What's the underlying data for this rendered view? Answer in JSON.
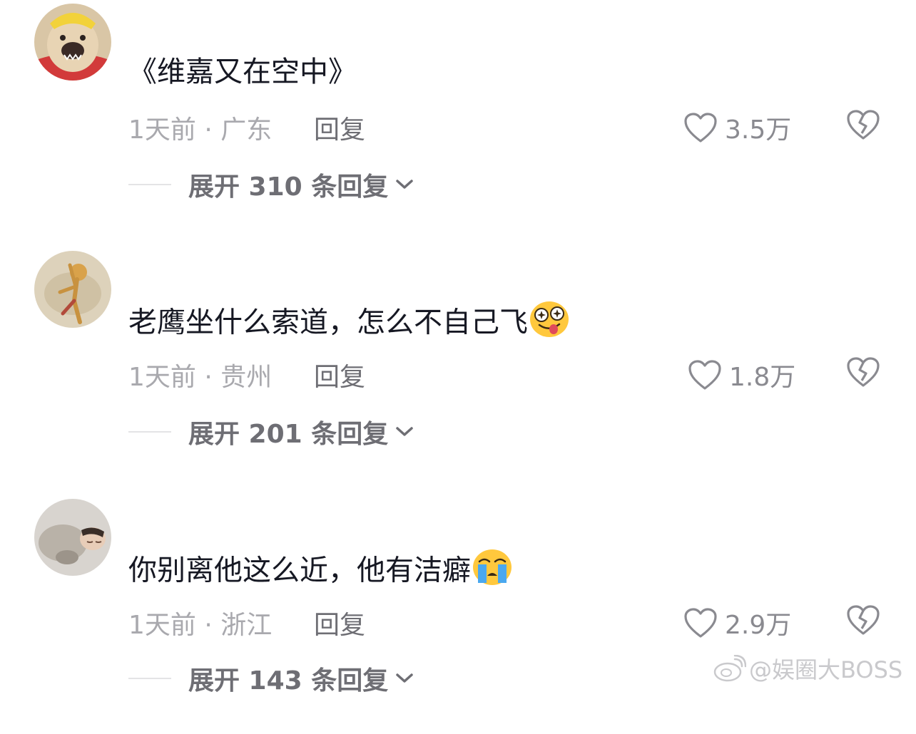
{
  "comments": [
    {
      "avatar": "shiba-dog-avatar",
      "text": "《维嘉又在空中》",
      "emoji": "",
      "time_location": "1天前 · 广东",
      "reply_label": "回复",
      "like_count": "3.5万",
      "expand_label": "展开 310 条回复"
    },
    {
      "avatar": "dancing-figure-avatar",
      "text": "老鹰坐什么索道，怎么不自己飞",
      "emoji": "drooling-star-eyes-emoji",
      "time_location": "1天前 · 贵州",
      "reply_label": "回复",
      "like_count": "1.8万",
      "expand_label": "展开 201 条回复"
    },
    {
      "avatar": "sleeping-child-avatar",
      "text": "你别离他这么近，他有洁癖",
      "emoji": "crying-emoji",
      "time_location": "1天前 · 浙江",
      "reply_label": "回复",
      "like_count": "2.9万",
      "expand_label": "展开 143 条回复"
    }
  ],
  "watermark": {
    "text": "@娱圈大BOSS",
    "icon": "weibo-icon"
  },
  "colors": {
    "primary_text": "#161823",
    "meta_text": "#a9a9ae",
    "secondary_text": "#6e6e74",
    "emoji_yellow": "#ffc83d"
  }
}
